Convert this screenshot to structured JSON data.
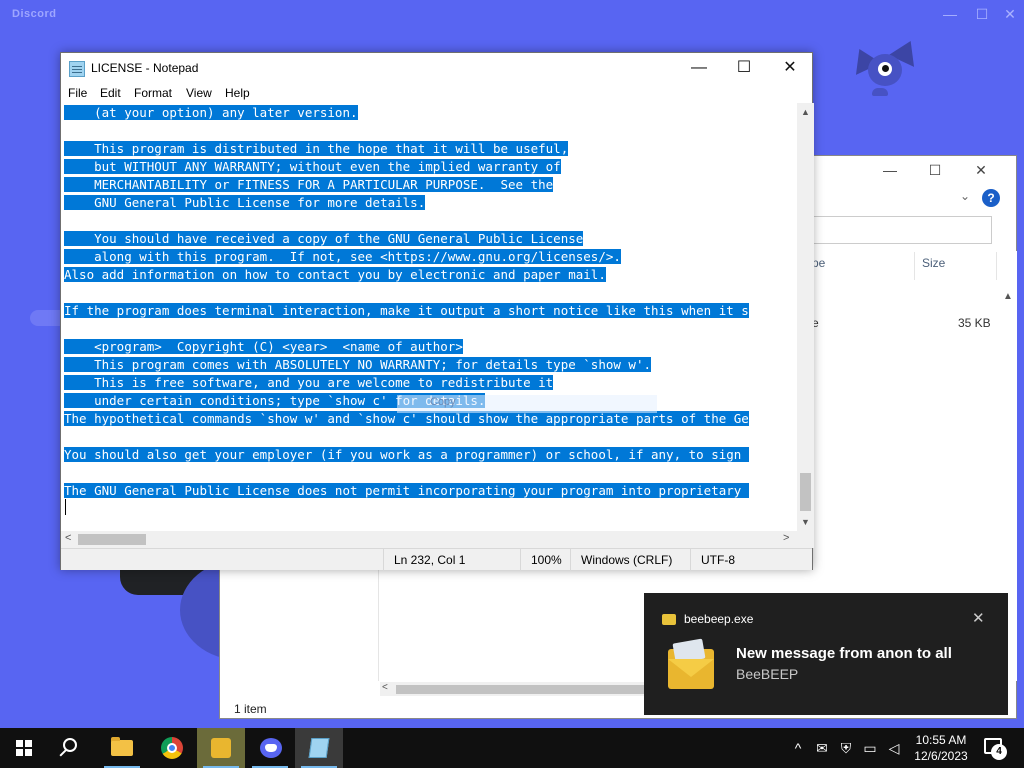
{
  "discord": {
    "logo_text": "Discord",
    "minimize_glyph": "—",
    "maximize_glyph": "☐",
    "close_glyph": "✕"
  },
  "explorer": {
    "minimize_glyph": "—",
    "maximize_glyph": "☐",
    "close_glyph": "✕",
    "columns": [
      {
        "label": "pe"
      },
      {
        "label": "Size"
      }
    ],
    "row": {
      "type_fragment": "e",
      "size": "35 KB"
    },
    "status": "1 item",
    "help_glyph": "?"
  },
  "notepad": {
    "title": "LICENSE - Notepad",
    "menu": [
      "File",
      "Edit",
      "Format",
      "View",
      "Help"
    ],
    "lines": [
      "    (at your option) any later version.",
      "",
      "    This program is distributed in the hope that it will be useful,",
      "    but WITHOUT ANY WARRANTY; without even the implied warranty of",
      "    MERCHANTABILITY or FITNESS FOR A PARTICULAR PURPOSE.  See the",
      "    GNU General Public License for more details.",
      "",
      "    You should have received a copy of the GNU General Public License",
      "    along with this program.  If not, see <https://www.gnu.org/licenses/>.",
      "Also add information on how to contact you by electronic and paper mail.",
      "",
      "If the program does terminal interaction, make it output a short notice like this when it s",
      "",
      "    <program>  Copyright (C) <year>  <name of author>",
      "    This program comes with ABSOLUTELY NO WARRANTY; for details type `show w'.",
      "    This is free software, and you are welcome to redistribute it",
      "    under certain conditions; type `show c' for details.",
      "The hypothetical commands `show w' and `show c' should show the appropriate parts of the Ge",
      "",
      "You should also get your employer (if you work as a programmer) or school, if any, to sign ",
      "",
      "The GNU General Public License does not permit incorporating your program into proprietary "
    ],
    "copy_hint": "Copy",
    "status": {
      "position": "Ln 232, Col 1",
      "zoom": "100%",
      "line_ending": "Windows (CRLF)",
      "encoding": "UTF-8"
    }
  },
  "toast": {
    "app": "beebeep.exe",
    "title": "New message from anon to all",
    "subtitle": "BeeBEEP",
    "close_glyph": "✕"
  },
  "taskbar": {
    "apps": [
      {
        "name": "start",
        "icon": "windows-logo-icon"
      },
      {
        "name": "search",
        "icon": "search-icon"
      },
      {
        "name": "file-explorer",
        "icon": "folder-icon"
      },
      {
        "name": "chrome",
        "icon": "chrome-icon"
      },
      {
        "name": "beebeep",
        "icon": "beebeep-icon"
      },
      {
        "name": "discord",
        "icon": "discord-icon"
      },
      {
        "name": "notepad",
        "icon": "notepad-icon"
      }
    ],
    "tray": {
      "chevron": "^",
      "time": "10:55 AM",
      "date": "12/6/2023",
      "notification_count": "4"
    }
  }
}
